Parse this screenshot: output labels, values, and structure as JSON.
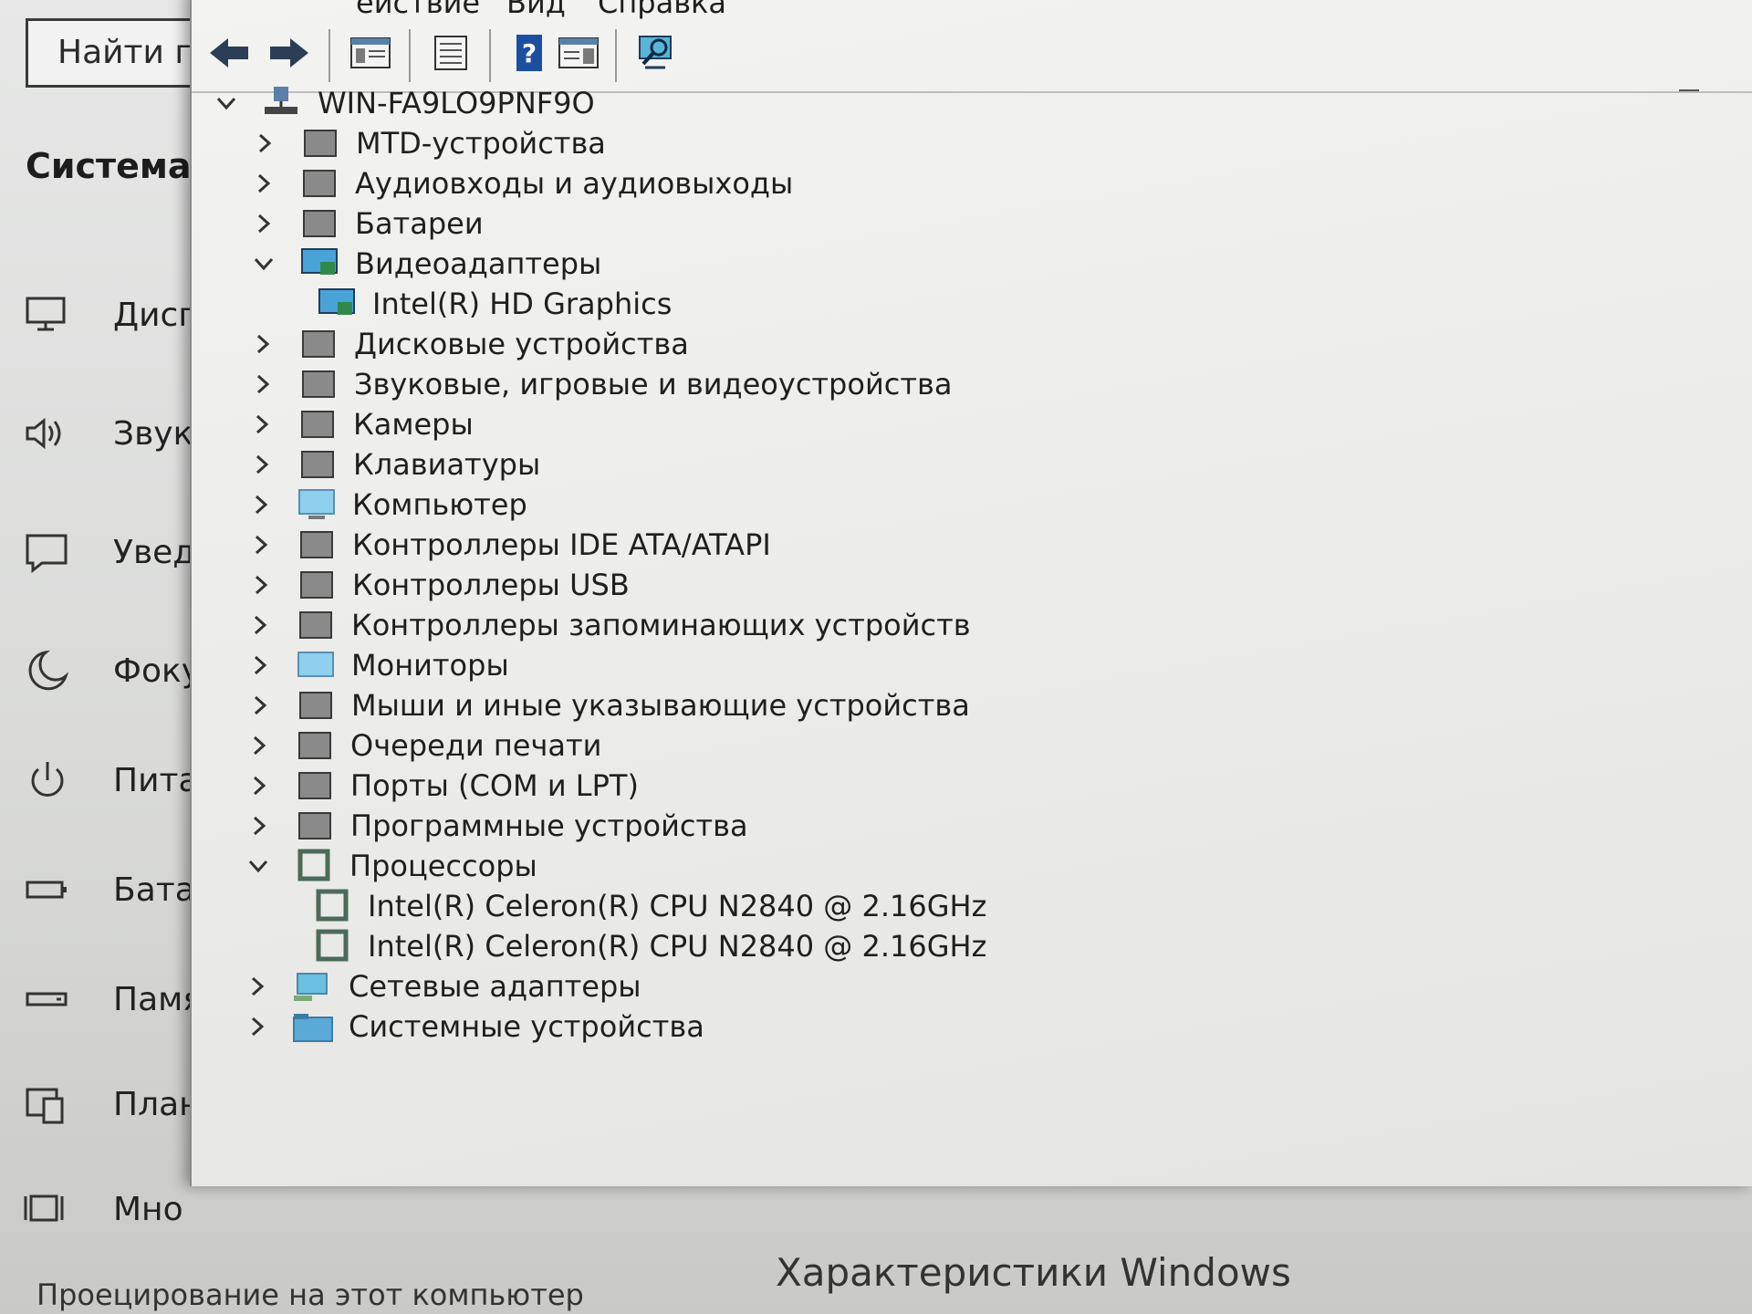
{
  "settings": {
    "search_label": "Найти п",
    "heading": "Система",
    "nav": [
      {
        "label": "Дисп",
        "icon": "display-icon"
      },
      {
        "label": "Звук",
        "icon": "speaker-icon"
      },
      {
        "label": "Увед",
        "icon": "notification-icon"
      },
      {
        "label": "Фоку",
        "icon": "moon-icon"
      },
      {
        "label": "Пита",
        "icon": "power-icon"
      },
      {
        "label": "Батар",
        "icon": "battery-icon"
      },
      {
        "label": "Памя",
        "icon": "storage-icon"
      },
      {
        "label": "План",
        "icon": "tablet-icon"
      },
      {
        "label": "Мно",
        "icon": "multitask-icon"
      }
    ],
    "footer_item": "Проецирование на этот компьютер",
    "windows_spec": "Характеристики Windows"
  },
  "devmgr": {
    "menu": [
      "ействие",
      "Вид",
      "Справка"
    ],
    "toolbar": [
      "back-icon",
      "forward-icon",
      "properties-pane-icon",
      "properties-icon",
      "help-icon",
      "action-pane-icon",
      "monitor-scan-icon"
    ],
    "root": "WIN-FA9LO9PNF9O",
    "categories": [
      {
        "label": "MTD-устройства",
        "expanded": false,
        "icon": "mtd-icon"
      },
      {
        "label": "Аудиовходы и аудиовыходы",
        "expanded": false,
        "icon": "audio-icon"
      },
      {
        "label": "Батареи",
        "expanded": false,
        "icon": "battery-icon"
      },
      {
        "label": "Видеоадаптеры",
        "expanded": true,
        "icon": "display-adapter-icon",
        "children": [
          "Intel(R) HD Graphics"
        ]
      },
      {
        "label": "Дисковые устройства",
        "expanded": false,
        "icon": "disk-icon"
      },
      {
        "label": "Звуковые, игровые и видеоустройства",
        "expanded": false,
        "icon": "sound-icon"
      },
      {
        "label": "Камеры",
        "expanded": false,
        "icon": "camera-icon"
      },
      {
        "label": "Клавиатуры",
        "expanded": false,
        "icon": "keyboard-icon"
      },
      {
        "label": "Компьютер",
        "expanded": false,
        "icon": "computer-icon"
      },
      {
        "label": "Контроллеры IDE ATA/ATAPI",
        "expanded": false,
        "icon": "ide-icon"
      },
      {
        "label": "Контроллеры USB",
        "expanded": false,
        "icon": "usb-icon"
      },
      {
        "label": "Контроллеры запоминающих устройств",
        "expanded": false,
        "icon": "storage-controller-icon"
      },
      {
        "label": "Мониторы",
        "expanded": false,
        "icon": "monitor-icon"
      },
      {
        "label": "Мыши и иные указывающие устройства",
        "expanded": false,
        "icon": "mouse-icon"
      },
      {
        "label": "Очереди печати",
        "expanded": false,
        "icon": "printer-icon"
      },
      {
        "label": "Порты (COM и LPT)",
        "expanded": false,
        "icon": "port-icon"
      },
      {
        "label": "Программные устройства",
        "expanded": false,
        "icon": "software-device-icon"
      },
      {
        "label": "Процессоры",
        "expanded": true,
        "icon": "processor-icon",
        "children": [
          "Intel(R) Celeron(R) CPU  N2840  @ 2.16GHz",
          "Intel(R) Celeron(R) CPU  N2840  @ 2.16GHz"
        ]
      },
      {
        "label": "Сетевые адаптеры",
        "expanded": false,
        "icon": "network-icon"
      },
      {
        "label": "Системные устройства",
        "expanded": false,
        "icon": "system-device-icon"
      }
    ]
  },
  "colors": {
    "accent": "#1c75bc",
    "folder": "#4aa3d8",
    "processor": "#4a6b58"
  }
}
